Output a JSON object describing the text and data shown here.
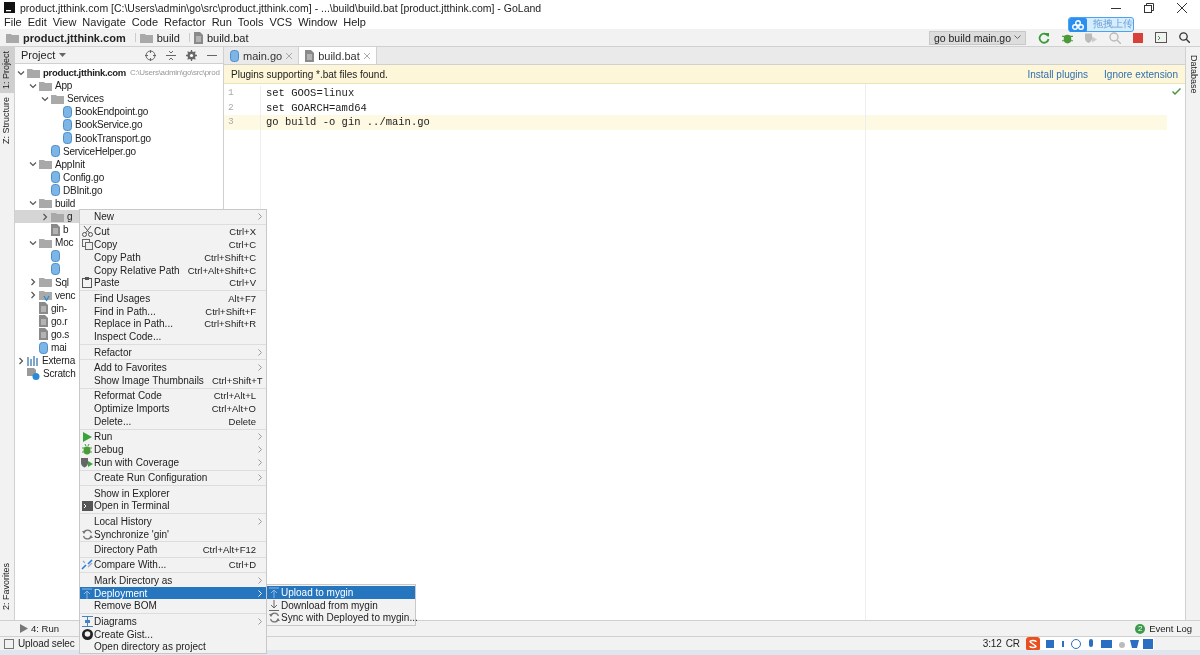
{
  "window": {
    "title": "product.jtthink.com [C:\\Users\\admin\\go\\src\\product.jtthink.com] - ...\\build\\build.bat [product.jtthink.com] - GoLand"
  },
  "menu_bar": [
    "File",
    "Edit",
    "View",
    "Navigate",
    "Code",
    "Refactor",
    "Run",
    "Tools",
    "VCS",
    "Window",
    "Help"
  ],
  "breadcrumbs": [
    {
      "label": "product.jtthink.com",
      "kind": "folder"
    },
    {
      "label": "build",
      "kind": "folder"
    },
    {
      "label": "build.bat",
      "kind": "batfile"
    }
  ],
  "run_config": "go build main.go",
  "upload_badge": "拖拽上传",
  "left_stripe": [
    {
      "label": "1: Project",
      "selected": true
    },
    {
      "label": "Z: Structure",
      "selected": false
    },
    {
      "label": "2: Favorites",
      "selected": false
    }
  ],
  "right_stripe": [
    {
      "label": "Database",
      "selected": false
    }
  ],
  "project_panel": {
    "title": "Project"
  },
  "tree": [
    {
      "label": "product.jtthink.com",
      "path": "C:\\Users\\admin\\go\\src\\prod",
      "kind": "folder",
      "expanded": true,
      "selected": false,
      "children": [
        {
          "label": "App",
          "kind": "folder",
          "expanded": true,
          "selected": false,
          "children": [
            {
              "label": "Services",
              "kind": "folder",
              "expanded": true,
              "selected": false,
              "children": [
                {
                  "label": "BookEndpoint.go",
                  "kind": "gofile",
                  "selected": false
                },
                {
                  "label": "BookService.go",
                  "kind": "gofile",
                  "selected": false
                },
                {
                  "label": "BookTransport.go",
                  "kind": "gofile",
                  "selected": false
                }
              ]
            },
            {
              "label": "ServiceHelper.go",
              "kind": "gofile",
              "selected": false
            }
          ]
        },
        {
          "label": "AppInit",
          "kind": "folder",
          "expanded": true,
          "selected": false,
          "children": [
            {
              "label": "Config.go",
              "kind": "gofile",
              "selected": false
            },
            {
              "label": "DBInit.go",
              "kind": "gofile",
              "selected": false
            }
          ]
        },
        {
          "label": "build",
          "kind": "folder",
          "expanded": true,
          "selected": false,
          "children": [
            {
              "label": "g",
              "kind": "folder",
              "expanded": false,
              "selected": true
            },
            {
              "label": "b",
              "kind": "batfile",
              "selected": false
            }
          ]
        },
        {
          "label": "Moc",
          "kind": "folder",
          "expanded": true,
          "selected": false,
          "children": [
            {
              "kind": "gofile",
              "selected": false
            },
            {
              "kind": "gofile",
              "selected": false
            }
          ]
        },
        {
          "label": "Sql",
          "kind": "folder",
          "expanded": false,
          "selected": false
        },
        {
          "label": "venc",
          "kind": "vendor",
          "expanded": false,
          "selected": false
        },
        {
          "label": "gin-",
          "kind": "batfile",
          "selected": false
        },
        {
          "label": "go.r",
          "kind": "batfile",
          "selected": false
        },
        {
          "label": "go.s",
          "kind": "batfile",
          "selected": false
        },
        {
          "label": "mai",
          "kind": "gofile",
          "selected": false
        }
      ]
    },
    {
      "label": "Externa",
      "kind": "libraries",
      "expanded": false,
      "selected": false
    },
    {
      "label": "Scratch",
      "kind": "scratches",
      "selected": false
    }
  ],
  "editor_tabs": [
    {
      "label": "main.go",
      "kind": "gofile",
      "selected": false
    },
    {
      "label": "build.bat",
      "kind": "batfile",
      "selected": true
    }
  ],
  "banner": {
    "text": "Plugins supporting *.bat files found.",
    "actions": [
      "Install plugins",
      "Ignore extension"
    ]
  },
  "code_lines": [
    {
      "number": "1",
      "text": "set GOOS=linux",
      "current": false
    },
    {
      "number": "2",
      "text": "set GOARCH=amd64",
      "current": false
    },
    {
      "number": "3",
      "text": "go build -o gin ../main.go",
      "current": true
    }
  ],
  "context_menu": [
    [
      {
        "label": "New",
        "submenu": true,
        "selected": false
      }
    ],
    [
      {
        "label": "Cut",
        "kind": "cut",
        "shortcut": "Ctrl+X",
        "selected": false
      },
      {
        "label": "Copy",
        "kind": "copy",
        "shortcut": "Ctrl+C",
        "selected": false
      },
      {
        "label": "Copy Path",
        "shortcut": "Ctrl+Shift+C",
        "selected": false
      },
      {
        "label": "Copy Relative Path",
        "shortcut": "Ctrl+Alt+Shift+C",
        "selected": false
      },
      {
        "label": "Paste",
        "kind": "paste",
        "shortcut": "Ctrl+V",
        "selected": false
      }
    ],
    [
      {
        "label": "Find Usages",
        "shortcut": "Alt+F7",
        "selected": false
      },
      {
        "label": "Find in Path...",
        "shortcut": "Ctrl+Shift+F",
        "selected": false
      },
      {
        "label": "Replace in Path...",
        "shortcut": "Ctrl+Shift+R",
        "selected": false
      },
      {
        "label": "Inspect Code...",
        "selected": false
      }
    ],
    [
      {
        "label": "Refactor",
        "submenu": true,
        "selected": false
      }
    ],
    [
      {
        "label": "Add to Favorites",
        "submenu": true,
        "selected": false
      },
      {
        "label": "Show Image Thumbnails",
        "shortcut": "Ctrl+Shift+T",
        "selected": false
      }
    ],
    [
      {
        "label": "Reformat Code",
        "shortcut": "Ctrl+Alt+L",
        "selected": false
      },
      {
        "label": "Optimize Imports",
        "shortcut": "Ctrl+Alt+O",
        "selected": false
      },
      {
        "label": "Delete...",
        "shortcut": "Delete",
        "selected": false
      }
    ],
    [
      {
        "label": "Run",
        "kind": "run",
        "submenu": true,
        "selected": false
      },
      {
        "label": "Debug",
        "kind": "debug",
        "submenu": true,
        "selected": false
      },
      {
        "label": "Run with Coverage",
        "kind": "coverage",
        "submenu": true,
        "selected": false
      }
    ],
    [
      {
        "label": "Create Run Configuration",
        "submenu": true,
        "selected": false
      }
    ],
    [
      {
        "label": "Show in Explorer",
        "selected": false
      },
      {
        "label": "Open in Terminal",
        "kind": "terminal",
        "selected": false
      }
    ],
    [
      {
        "label": "Local History",
        "submenu": true,
        "selected": false
      },
      {
        "label": "Synchronize 'gin'",
        "kind": "sync",
        "selected": false
      }
    ],
    [
      {
        "label": "Directory Path",
        "shortcut": "Ctrl+Alt+F12",
        "selected": false
      }
    ],
    [
      {
        "label": "Compare With...",
        "kind": "compare",
        "shortcut": "Ctrl+D",
        "selected": false
      }
    ],
    [
      {
        "label": "Mark Directory as",
        "submenu": true,
        "selected": false
      },
      {
        "label": "Deployment",
        "kind": "deploy",
        "submenu": true,
        "selected": true
      },
      {
        "label": "Remove BOM",
        "selected": false
      }
    ],
    [
      {
        "label": "Diagrams",
        "kind": "diagram",
        "submenu": true,
        "selected": false
      },
      {
        "label": "Create Gist...",
        "kind": "gist",
        "selected": false
      },
      {
        "label": "Open directory as project",
        "selected": false
      }
    ]
  ],
  "submenu": [
    {
      "label": "Upload to mygin",
      "kind": "upload",
      "selected": true
    },
    {
      "label": "Download from mygin",
      "kind": "download",
      "selected": false
    },
    {
      "label": "Sync with Deployed to mygin...",
      "kind": "sync",
      "selected": false
    }
  ],
  "tool_windows": {
    "run": "4: Run",
    "event_log": "Event Log",
    "event_count": "2"
  },
  "status_bar": {
    "message": "Upload selec",
    "position": "3:12",
    "line_separator": "CR"
  }
}
